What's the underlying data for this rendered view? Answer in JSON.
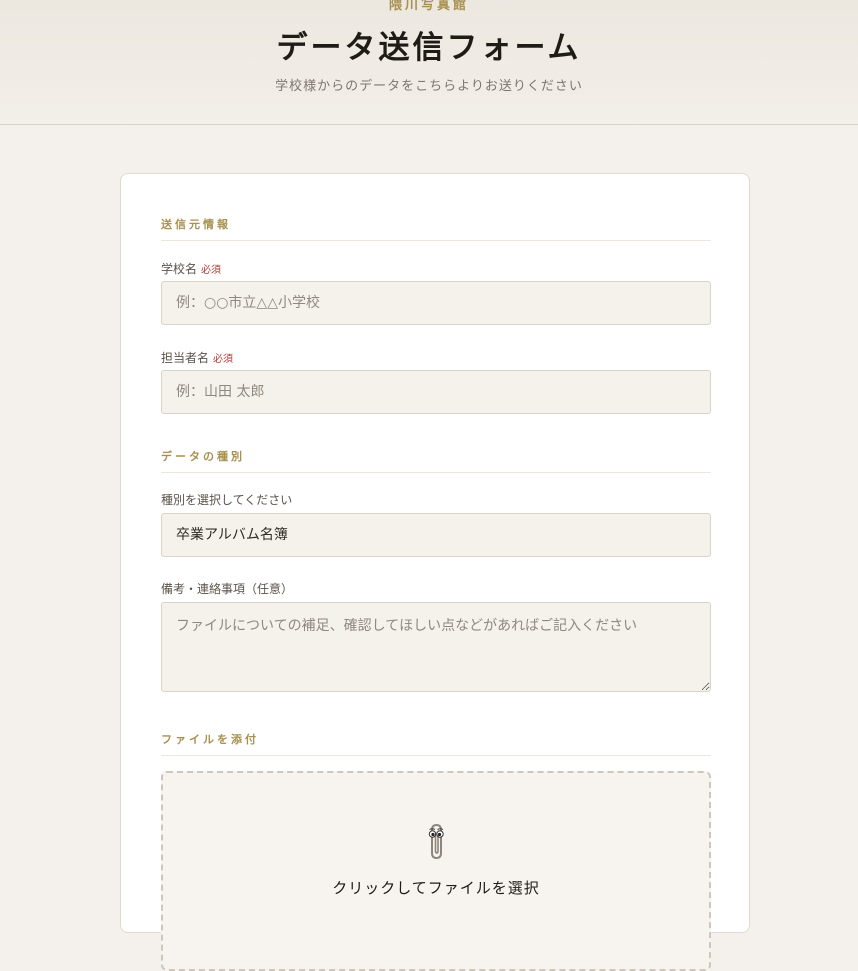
{
  "header": {
    "brand": "隈川写真館",
    "title": "データ送信フォーム",
    "subtitle": "学校様からのデータをこちらよりお送りください"
  },
  "sections": {
    "sender": "送信元情報",
    "data_type": "データの種別",
    "attach": "ファイルを添付"
  },
  "fields": {
    "school": {
      "label": "学校名",
      "required": "必須",
      "placeholder": "例：○○市立△△小学校"
    },
    "person": {
      "label": "担当者名",
      "required": "必須",
      "placeholder": "例：山田 太郎"
    },
    "type": {
      "label": "種別を選択してください",
      "value": "卒業アルバム名簿"
    },
    "notes": {
      "label": "備考・連絡事項（任意）",
      "placeholder": "ファイルについての補足、確認してほしい点などがあればご記入ください"
    }
  },
  "dropzone": {
    "icon": "paperclip-icon",
    "text": "クリックしてファイルを選択"
  }
}
